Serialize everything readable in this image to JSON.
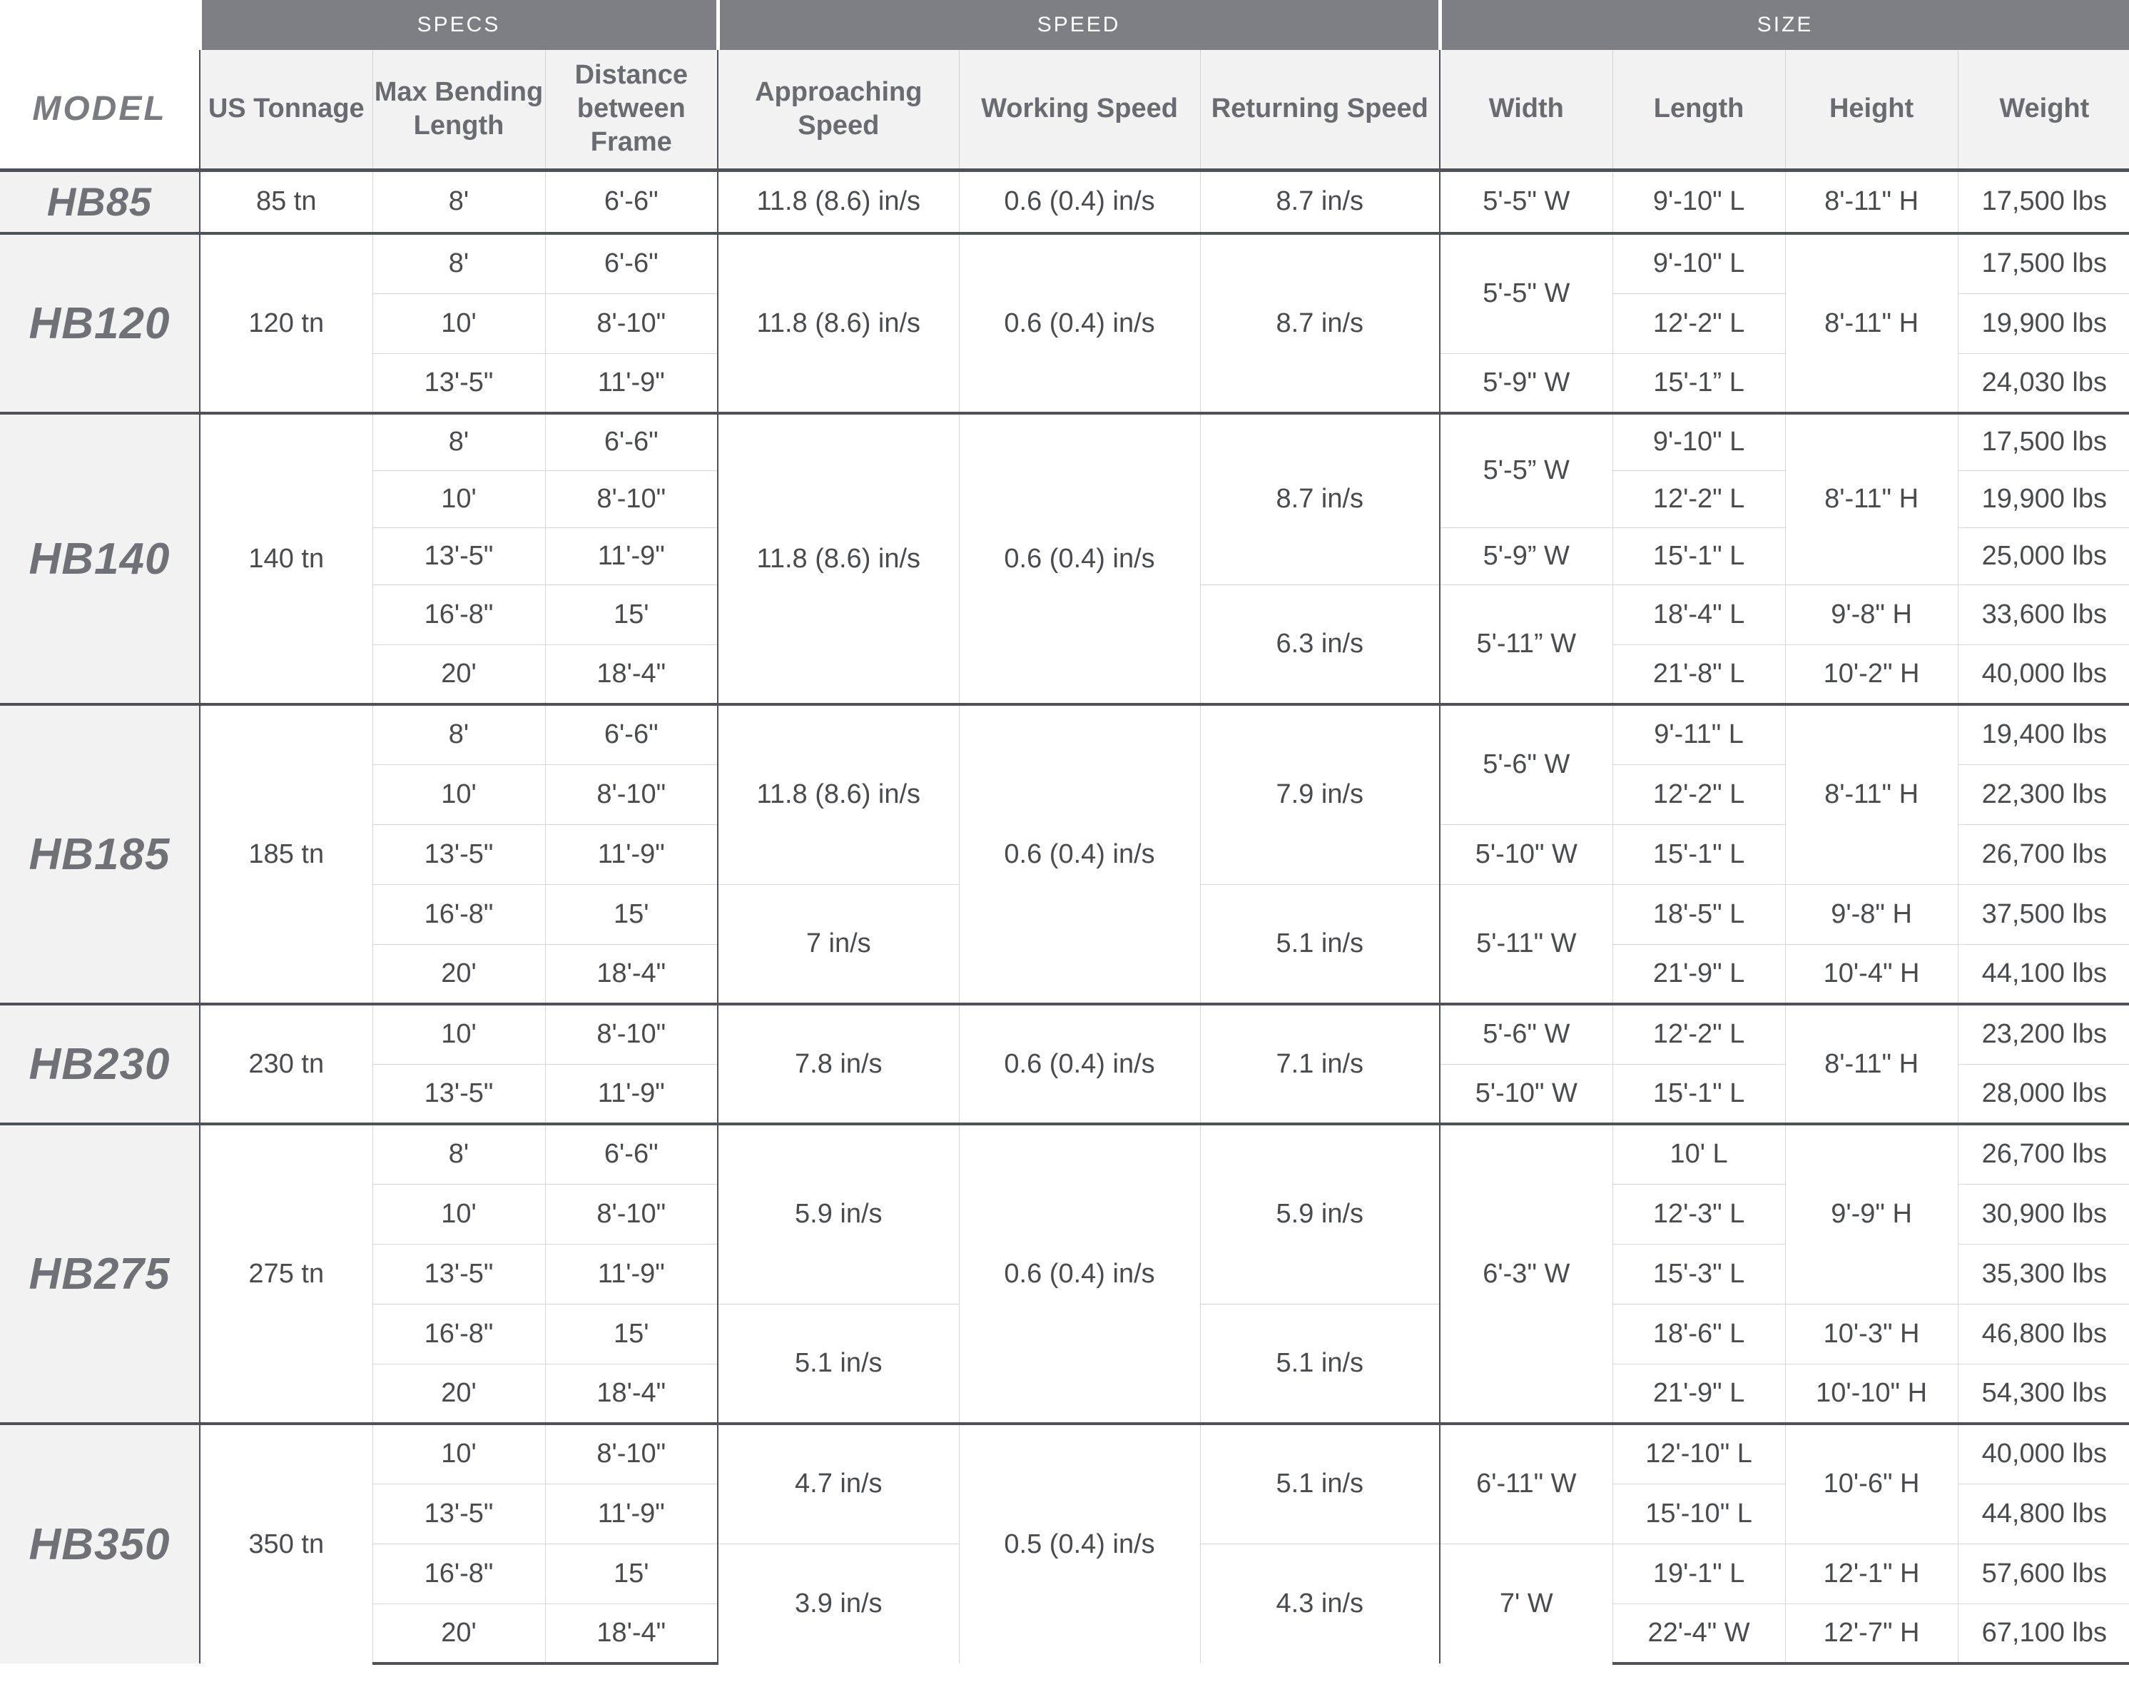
{
  "header": {
    "model": "MODEL",
    "groups": {
      "specs": "SPECS",
      "speed": "SPEED",
      "size": "SIZE"
    },
    "columns": {
      "tonnage": "US Tonnage",
      "bending": "Max Bending Length",
      "distance": "Distance between Frame",
      "approaching": "Approaching Speed",
      "working": "Working Speed",
      "returning": "Returning Speed",
      "width": "Width",
      "length": "Length",
      "height": "Height",
      "weight": "Weight"
    }
  },
  "models": {
    "hb85": {
      "name": "HB85",
      "tonnage": "85 tn",
      "bend": [
        "8'"
      ],
      "dist": [
        "6'-6\""
      ],
      "appr": [
        "11.8 (8.6) in/s"
      ],
      "work": [
        "0.6 (0.4) in/s"
      ],
      "ret": [
        "8.7 in/s"
      ],
      "width": [
        "5'-5\" W"
      ],
      "length": [
        "9'-10\" L"
      ],
      "height": [
        "8'-11\" H"
      ],
      "weight": [
        "17,500 lbs"
      ]
    },
    "hb120": {
      "name": "HB120",
      "tonnage": "120 tn",
      "bend": [
        "8'",
        "10'",
        "13'-5\""
      ],
      "dist": [
        "6'-6\"",
        "8'-10\"",
        "11'-9\""
      ],
      "appr": [
        "11.8 (8.6) in/s"
      ],
      "work": [
        "0.6 (0.4) in/s"
      ],
      "ret": [
        "8.7 in/s"
      ],
      "width": [
        "5'-5\" W",
        "5'-9\" W"
      ],
      "length": [
        "9'-10\" L",
        "12'-2\" L",
        "15'-1” L"
      ],
      "height": [
        "8'-11\" H"
      ],
      "weight": [
        "17,500 lbs",
        "19,900 lbs",
        "24,030 lbs"
      ]
    },
    "hb140": {
      "name": "HB140",
      "tonnage": "140 tn",
      "bend": [
        "8'",
        "10'",
        "13'-5\"",
        "16'-8\"",
        "20'"
      ],
      "dist": [
        "6'-6\"",
        "8'-10\"",
        "11'-9\"",
        "15'",
        "18'-4\""
      ],
      "appr": [
        "11.8 (8.6) in/s"
      ],
      "work": [
        "0.6 (0.4) in/s"
      ],
      "ret": [
        "8.7 in/s",
        "6.3 in/s"
      ],
      "width": [
        "5'-5” W",
        "5'-9” W",
        "5'-11” W"
      ],
      "length": [
        "9'-10\" L",
        "12'-2\" L",
        "15'-1\" L",
        "18'-4\" L",
        "21'-8\" L"
      ],
      "height": [
        "8'-11\" H",
        "9'-8\" H",
        "10'-2\" H"
      ],
      "weight": [
        "17,500 lbs",
        "19,900 lbs",
        "25,000 lbs",
        "33,600 lbs",
        "40,000 lbs"
      ]
    },
    "hb185": {
      "name": "HB185",
      "tonnage": "185 tn",
      "bend": [
        "8'",
        "10'",
        "13'-5\"",
        "16'-8\"",
        "20'"
      ],
      "dist": [
        "6'-6\"",
        "8'-10\"",
        "11'-9\"",
        "15'",
        "18'-4\""
      ],
      "appr": [
        "11.8 (8.6) in/s",
        "7 in/s"
      ],
      "work": [
        "0.6 (0.4) in/s"
      ],
      "ret": [
        "7.9 in/s",
        "5.1 in/s"
      ],
      "width": [
        "5'-6\" W",
        "5'-10\" W",
        "5'-11\" W"
      ],
      "length": [
        "9'-11\" L",
        "12'-2\" L",
        "15'-1\" L",
        "18'-5\" L",
        "21'-9\" L"
      ],
      "height": [
        "8'-11\" H",
        "9'-8\" H",
        "10'-4\" H"
      ],
      "weight": [
        "19,400 lbs",
        "22,300 lbs",
        "26,700 lbs",
        "37,500 lbs",
        "44,100 lbs"
      ]
    },
    "hb230": {
      "name": "HB230",
      "tonnage": "230 tn",
      "bend": [
        "10'",
        "13'-5\""
      ],
      "dist": [
        "8'-10\"",
        "11'-9\""
      ],
      "appr": [
        "7.8 in/s"
      ],
      "work": [
        "0.6 (0.4) in/s"
      ],
      "ret": [
        "7.1 in/s"
      ],
      "width": [
        "5'-6\" W",
        "5'-10\" W"
      ],
      "length": [
        "12'-2\" L",
        "15'-1\" L"
      ],
      "height": [
        "8'-11\" H"
      ],
      "weight": [
        "23,200 lbs",
        "28,000 lbs"
      ]
    },
    "hb275": {
      "name": "HB275",
      "tonnage": "275 tn",
      "bend": [
        "8'",
        "10'",
        "13'-5\"",
        "16'-8\"",
        "20'"
      ],
      "dist": [
        "6'-6\"",
        "8'-10\"",
        "11'-9\"",
        "15'",
        "18'-4\""
      ],
      "appr": [
        "5.9 in/s",
        "5.1 in/s"
      ],
      "work": [
        "0.6 (0.4) in/s"
      ],
      "ret": [
        "5.9 in/s",
        "5.1 in/s"
      ],
      "width": [
        "6'-3\" W"
      ],
      "length": [
        "10' L",
        "12'-3\" L",
        "15'-3\" L",
        "18'-6\" L",
        "21'-9\" L"
      ],
      "height": [
        "9'-9\" H",
        "10'-3\" H",
        "10'-10\" H"
      ],
      "weight": [
        "26,700 lbs",
        "30,900 lbs",
        "35,300 lbs",
        "46,800 lbs",
        "54,300 lbs"
      ]
    },
    "hb350": {
      "name": "HB350",
      "tonnage": "350 tn",
      "bend": [
        "10'",
        "13'-5\"",
        "16'-8\"",
        "20'"
      ],
      "dist": [
        "8'-10\"",
        "11'-9\"",
        "15'",
        "18'-4\""
      ],
      "appr": [
        "4.7 in/s",
        "3.9 in/s"
      ],
      "work": [
        "0.5 (0.4) in/s"
      ],
      "ret": [
        "5.1 in/s",
        "4.3 in/s"
      ],
      "width": [
        "6'-11\" W",
        "7' W"
      ],
      "length": [
        "12'-10\" L",
        "15'-10\" L",
        "19'-1\" L",
        "22'-4\" W"
      ],
      "height": [
        "10'-6\" H",
        "12'-1\" H",
        "12'-7\" H"
      ],
      "weight": [
        "40,000 lbs",
        "44,800 lbs",
        "57,600 lbs",
        "67,100 lbs"
      ]
    }
  }
}
